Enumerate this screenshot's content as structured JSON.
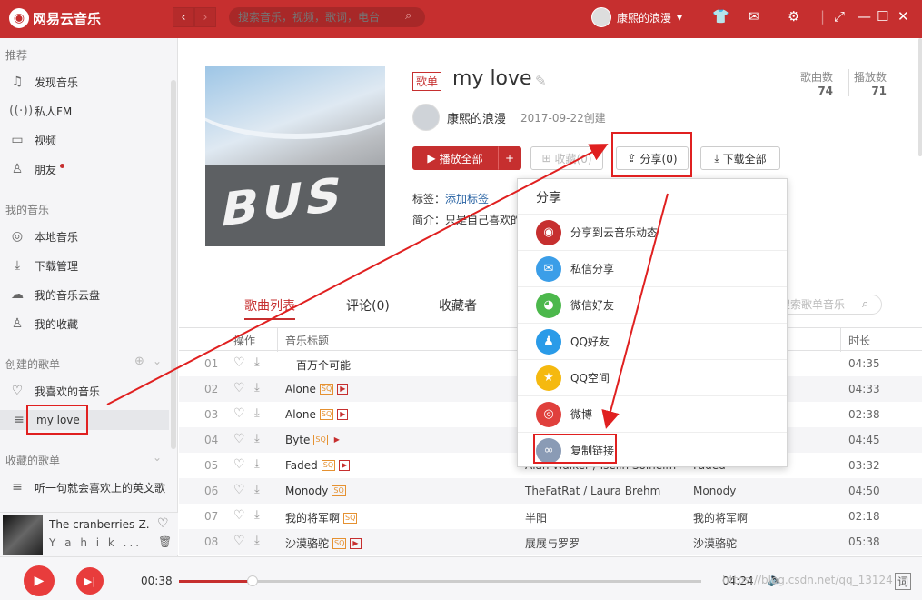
{
  "app": {
    "name": "网易云音乐"
  },
  "search": {
    "placeholder": "搜索音乐，视频，歌词，电台"
  },
  "user": {
    "name": "康熙的浪漫"
  },
  "sidebar": {
    "sec_recommend": "推荐",
    "recommend": [
      {
        "label": "发现音乐",
        "icon": "music-note-icon"
      },
      {
        "label": "私人FM",
        "icon": "radio-icon"
      },
      {
        "label": "视频",
        "icon": "video-icon"
      },
      {
        "label": "朋友",
        "icon": "friends-icon"
      }
    ],
    "sec_my": "我的音乐",
    "my": [
      {
        "label": "本地音乐",
        "icon": "disc-icon"
      },
      {
        "label": "下载管理",
        "icon": "download-icon"
      },
      {
        "label": "我的音乐云盘",
        "icon": "cloud-icon"
      },
      {
        "label": "我的收藏",
        "icon": "collection-icon"
      }
    ],
    "sec_created": "创建的歌单",
    "created": [
      {
        "label": "我喜欢的音乐",
        "icon": "heart-icon"
      },
      {
        "label": "my love",
        "icon": "playlist-icon"
      }
    ],
    "sec_fav": "收藏的歌单",
    "fav": [
      {
        "label": "听一句就会喜欢上的英文歌",
        "icon": "playlist-icon"
      }
    ]
  },
  "now_playing": {
    "title": "The cranberries-Z...",
    "artist": "Y a h i k ..."
  },
  "playlist": {
    "tag": "歌单",
    "title": "my love",
    "creator": "康熙的浪漫",
    "created": "2017-09-22创建",
    "songs_label": "歌曲数",
    "songs_count": "74",
    "plays_label": "播放数",
    "plays_count": "71",
    "play_all": "播放全部",
    "add": "+",
    "collect": "收藏(0)",
    "share": "分享(0)",
    "download_all": "下载全部",
    "tags_label": "标签：",
    "tags_link": "添加标签",
    "desc_label": "简介：",
    "desc": "只是自己喜欢的"
  },
  "tabs": [
    "歌曲列表",
    "评论(0)",
    "收藏者"
  ],
  "list_search": {
    "placeholder": "搜索歌单音乐"
  },
  "table": {
    "headers": [
      "操作",
      "音乐标题",
      "歌手",
      "专辑",
      "时长"
    ],
    "rows": [
      {
        "no": "01",
        "title": "一百万个可能",
        "sq": false,
        "mv": false,
        "artist": "",
        "album": "",
        "dur": "04:35"
      },
      {
        "no": "02",
        "title": "Alone",
        "sq": true,
        "mv": true,
        "artist": "",
        "album": "",
        "dur": "04:33"
      },
      {
        "no": "03",
        "title": "Alone",
        "sq": true,
        "mv": true,
        "artist": "",
        "album": "",
        "dur": "02:38"
      },
      {
        "no": "04",
        "title": "Byte",
        "sq": true,
        "mv": true,
        "artist": "",
        "album": "",
        "dur": "04:45"
      },
      {
        "no": "05",
        "title": "Faded",
        "sq": true,
        "mv": true,
        "artist": "Alan Walker / Iselin Solheim",
        "album": "Faded",
        "dur": "03:32"
      },
      {
        "no": "06",
        "title": "Monody",
        "sq": true,
        "mv": false,
        "artist": "TheFatRat / Laura Brehm",
        "album": "Monody",
        "dur": "04:50"
      },
      {
        "no": "07",
        "title": "我的将军啊",
        "sq": true,
        "mv": false,
        "artist": "半阳",
        "album": "我的将军啊",
        "dur": "02:18"
      },
      {
        "no": "08",
        "title": "沙漠骆驼",
        "sq": true,
        "mv": true,
        "artist": "展展与罗罗",
        "album": "沙漠骆驼",
        "dur": "05:38"
      }
    ]
  },
  "badges": {
    "sq": "SQ",
    "mv": "▶"
  },
  "share_menu": {
    "title": "分享",
    "items": [
      {
        "label": "分享到云音乐动态",
        "icon": "netease-icon",
        "color": "#c62f2f"
      },
      {
        "label": "私信分享",
        "icon": "mail-icon",
        "color": "#3b9ee8"
      },
      {
        "label": "微信好友",
        "icon": "wechat-icon",
        "color": "#4cb84c"
      },
      {
        "label": "QQ好友",
        "icon": "qq-icon",
        "color": "#2a9be8"
      },
      {
        "label": "QQ空间",
        "icon": "qzone-icon",
        "color": "#f5b90f"
      },
      {
        "label": "微博",
        "icon": "weibo-icon",
        "color": "#e0403c"
      },
      {
        "label": "复制链接",
        "icon": "link-icon",
        "color": "#8a9bb5"
      }
    ]
  },
  "player": {
    "elapsed": "00:38",
    "total": "04:24",
    "progress": 0.14,
    "lyric_btn": "词"
  },
  "watermark": "https://blog.csdn.net/qq_13124"
}
